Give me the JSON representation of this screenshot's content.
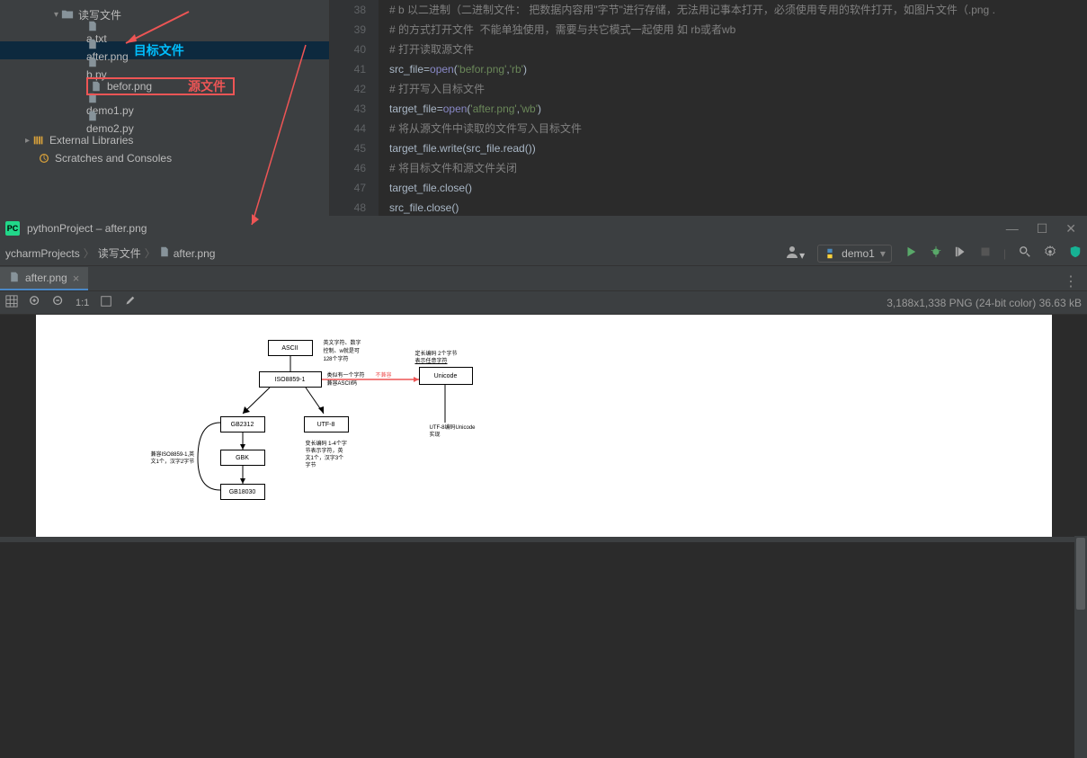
{
  "sidebar": {
    "folder": "读写文件",
    "items": [
      {
        "name": "a.txt",
        "selected": false
      },
      {
        "name": "after.png",
        "selected": true,
        "annotation": "目标文件"
      },
      {
        "name": "b.py",
        "selected": false
      },
      {
        "name": "befor.png",
        "selected": false,
        "annotation": "源文件",
        "redbox": true
      },
      {
        "name": "demo1.py",
        "selected": false
      },
      {
        "name": "demo2.py",
        "selected": false
      }
    ],
    "external": "External Libraries",
    "scratches": "Scratches and Consoles"
  },
  "editor": {
    "lines": [
      {
        "n": 38,
        "segments": [
          {
            "t": "# b 以二进制（二进制文件： 把数据内容用\"字节\"进行存储，无法用记事本打开，必须使用专用的软件打开，如图片文件（.png .",
            "cls": "c-comment"
          }
        ]
      },
      {
        "n": 39,
        "segments": [
          {
            "t": "# 的方式打开文件  不能单独使用，需要与共它模式一起使用 如 rb或者wb",
            "cls": "c-comment"
          }
        ]
      },
      {
        "n": 40,
        "segments": [
          {
            "t": "# 打开读取源文件",
            "cls": "c-comment"
          }
        ]
      },
      {
        "n": 41,
        "segments": [
          {
            "t": "src_file",
            "cls": "c-id"
          },
          {
            "t": "=",
            "cls": "c-op"
          },
          {
            "t": "open",
            "cls": "c-fn"
          },
          {
            "t": "(",
            "cls": "c-paren"
          },
          {
            "t": "'befor.png'",
            "cls": "c-str"
          },
          {
            "t": ",",
            "cls": "c-op"
          },
          {
            "t": "'rb'",
            "cls": "c-str"
          },
          {
            "t": ")",
            "cls": "c-paren"
          }
        ]
      },
      {
        "n": 42,
        "segments": [
          {
            "t": "# 打开写入目标文件",
            "cls": "c-comment"
          }
        ]
      },
      {
        "n": 43,
        "segments": [
          {
            "t": "target_file",
            "cls": "c-id"
          },
          {
            "t": "=",
            "cls": "c-op"
          },
          {
            "t": "open",
            "cls": "c-fn"
          },
          {
            "t": "(",
            "cls": "c-paren"
          },
          {
            "t": "'after.png'",
            "cls": "c-str"
          },
          {
            "t": ",",
            "cls": "c-op"
          },
          {
            "t": "'wb'",
            "cls": "c-str"
          },
          {
            "t": ")",
            "cls": "c-paren"
          }
        ]
      },
      {
        "n": 44,
        "segments": [
          {
            "t": "# 将从源文件中读取的文件写入目标文件",
            "cls": "c-comment"
          }
        ]
      },
      {
        "n": 45,
        "segments": [
          {
            "t": "target_file.write(src_file.read())",
            "cls": "c-id"
          }
        ]
      },
      {
        "n": 46,
        "segments": [
          {
            "t": "# 将目标文件和源文件关闭",
            "cls": "c-comment"
          }
        ]
      },
      {
        "n": 47,
        "segments": [
          {
            "t": "target_file.close()",
            "cls": "c-id"
          }
        ]
      },
      {
        "n": 48,
        "segments": [
          {
            "t": "src_file.close()",
            "cls": "c-id"
          }
        ]
      }
    ]
  },
  "window": {
    "title": "pythonProject – after.png",
    "breadcrumb": [
      "ycharmProjects",
      "读写文件",
      "after.png"
    ],
    "run_config": "demo1",
    "tab": "after.png",
    "image_info": "3,188x1,338 PNG (24-bit color) 36.63 kB"
  },
  "diagram": {
    "boxes": [
      "ASCII",
      "ISO8859-1",
      "Unicode",
      "GB2312",
      "UTF-8",
      "GBK",
      "GB18030"
    ]
  }
}
